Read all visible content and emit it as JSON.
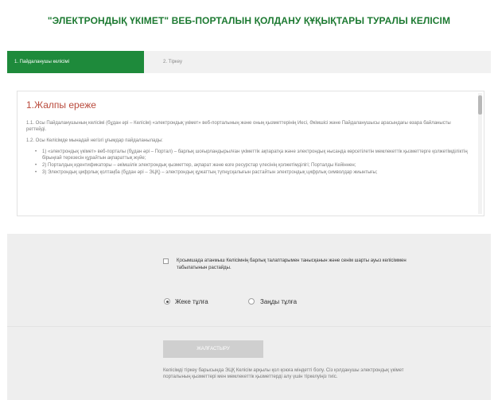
{
  "header": {
    "title": "\"ЭЛЕКТРОНДЫҚ ҮКІМЕТ\" ВЕБ-ПОРТАЛЫН ҚОЛДАНУ ҚҰҚЫҚТАРЫ ТУРАЛЫ КЕЛІСІМ"
  },
  "steps": {
    "step1_label": "1. Пайдаланушы келісімі",
    "step2_label": "2. Тіркеу"
  },
  "agreement": {
    "heading": "1.Жалпы ереже",
    "p1": "1.1. Осы Пайдаланушының келісімі (бұдан әрі – Келісім) «электрондық үкімет» веб-порталының және оның қызметтерінің Иесі, Әкімшісі және Пайдаланушысы арасындағы өзара байланысты реттейді.",
    "p2": "1.2. Осы Келісімде мынадай негізгі ұғымдар пайдаланылады:",
    "items": [
      "1) «электрондық үкімет» веб-порталы (бұдан әрі – Портал) – барлық шоғырландырылған үкіметтік ақпаратқа және электрондық нысанда көрсетілетін мемлекеттік қызметтерге қолжетімділіктің бірыңғай терезесін құрайтын ақпараттық жүйе;",
      "2) Порталдың идентификаторы – әкімшілік электрондық қызметтер, ақпарат және өзге ресурстар үлесінің қолжетімділігі; Порталды Кейіннен;",
      "3) Электрондық цифрлық қолтаңба (бұдан әрі – ЭЦҚ) – электрондық құжаттың түпнұсқалығын растайтын электрондық цифрлық символдар жиынтығы;"
    ]
  },
  "consent": {
    "text": "Қосымшада атанмыш Келісімнің барлық талаптарымен танысқанын және сенім шарты ауыз келісіммен табылатынын растайды."
  },
  "person_type": {
    "individual_label": "Жеке тұлға",
    "legal_label": "Заңды тұлға",
    "selected": "individual"
  },
  "form": {
    "submit_label": "ЖАЛҒАСТЫРУ",
    "note": "Келісімді тіркеу барысында ЭЦҚ Келісім арқылы қол қоюға міндетті болу. Сіз қолданушы электрондық үкімет порталының қызметтері мен мемлекеттік қызметтерді алу үшін тіркелуіңіз тиіс."
  },
  "colors": {
    "brand_green": "#1e8a3b",
    "title_green": "#1d7a32",
    "heading_red": "#b94a3c",
    "disabled_button": "#cfcfcf"
  }
}
